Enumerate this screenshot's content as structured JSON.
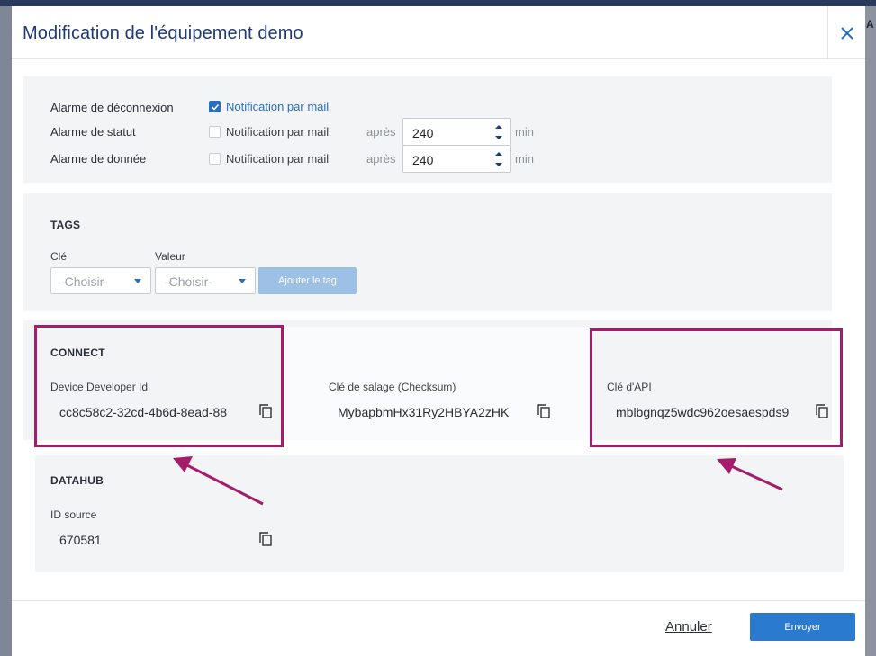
{
  "background": {
    "right_letter": "A",
    "right_sub": "A"
  },
  "modal": {
    "title": "Modification de l'équipement demo",
    "close_icon": "close-icon"
  },
  "alarms": {
    "disconnect": {
      "label": "Alarme de déconnexion",
      "checkbox_label": "Notification par mail",
      "checked": true
    },
    "status": {
      "label": "Alarme de statut",
      "checkbox_label": "Notification par mail",
      "checked": false,
      "after_label": "après",
      "value": "240",
      "unit": "min"
    },
    "data": {
      "label": "Alarme de donnée",
      "checkbox_label": "Notification par mail",
      "checked": false,
      "after_label": "après",
      "value": "240",
      "unit": "min"
    }
  },
  "tags": {
    "title": "TAGS",
    "key_label": "Clé",
    "value_label": "Valeur",
    "key_placeholder": "-Choisir-",
    "value_placeholder": "-Choisir-",
    "add_button": "Ajouter le tag"
  },
  "connect": {
    "title": "CONNECT",
    "developer_id_label": "Device Developer Id",
    "developer_id_value": "cc8c58c2-32cd-4b6d-8ead-88",
    "salt_label": "Clé de salage (Checksum)",
    "salt_value": "MybapbmHx31Ry2HBYA2zHK",
    "api_key_label": "Clé d'API",
    "api_key_value": "mblbgnqz5wdc962oesaespds9"
  },
  "datahub": {
    "title": "DATAHUB",
    "id_source_label": "ID source",
    "id_source_value": "670581"
  },
  "footer": {
    "cancel": "Annuler",
    "send": "Envoyer"
  },
  "colors": {
    "accent": "#2a6ebf",
    "highlight": "#a61c6a",
    "title": "#1f3a74"
  }
}
